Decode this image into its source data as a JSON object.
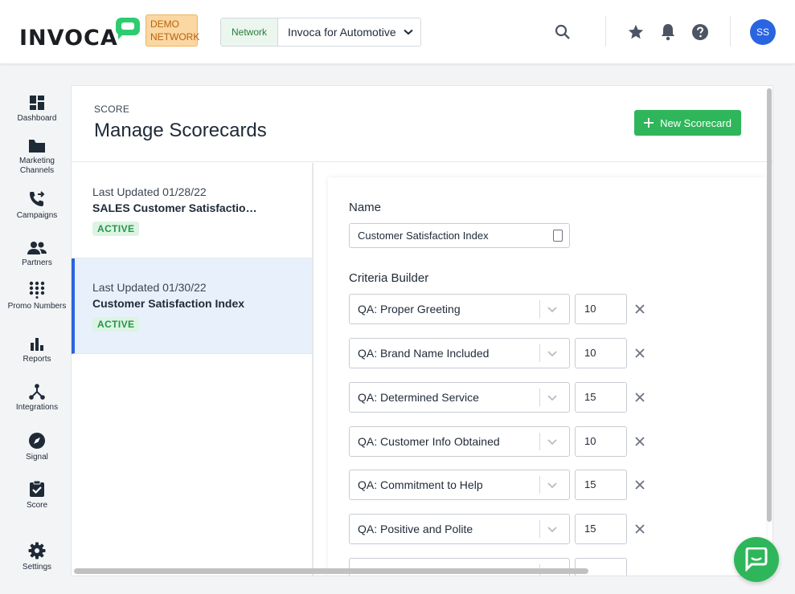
{
  "header": {
    "logo_text": "INVOCA",
    "demo_badge": "DEMO NETWORK",
    "network_tag": "Network",
    "network_value": "Invoca for Automotive",
    "avatar_initials": "SS",
    "icons": [
      "search-icon",
      "star-icon",
      "bell-icon",
      "help-icon"
    ]
  },
  "sidebar": {
    "items": [
      {
        "label": "Dashboard",
        "icon": "dashboard-icon"
      },
      {
        "label": "Marketing Channels",
        "icon": "folder-icon"
      },
      {
        "label": "Campaigns",
        "icon": "phone-forward-icon"
      },
      {
        "label": "Partners",
        "icon": "people-icon"
      },
      {
        "label": "Promo Numbers",
        "icon": "dialpad-icon"
      },
      {
        "label": "Reports",
        "icon": "bar-chart-icon"
      },
      {
        "label": "Integrations",
        "icon": "integrations-icon"
      },
      {
        "label": "Signal",
        "icon": "compass-icon"
      },
      {
        "label": "Score",
        "icon": "clipboard-check-icon"
      },
      {
        "label": "Settings",
        "icon": "gear-icon"
      }
    ]
  },
  "page": {
    "eyebrow": "SCORE",
    "title": "Manage Scorecards",
    "new_button": "New Scorecard"
  },
  "scorecards": [
    {
      "updated": "Last Updated 01/28/22",
      "name": "SALES Customer Satisfaction I...",
      "status": "ACTIVE",
      "selected": false
    },
    {
      "updated": "Last Updated 01/30/22",
      "name": "Customer Satisfaction Index",
      "status": "ACTIVE",
      "selected": true
    }
  ],
  "detail": {
    "name_label": "Name",
    "name_value": "Customer Satisfaction Index",
    "criteria_label": "Criteria Builder",
    "criteria": [
      {
        "criterion": "QA: Proper Greeting",
        "weight": "10"
      },
      {
        "criterion": "QA: Brand Name Included",
        "weight": "10"
      },
      {
        "criterion": "QA: Determined Service",
        "weight": "15"
      },
      {
        "criterion": "QA: Customer Info Obtained",
        "weight": "10"
      },
      {
        "criterion": "QA: Commitment to Help",
        "weight": "15"
      },
      {
        "criterion": "QA: Positive and Polite",
        "weight": "15"
      }
    ]
  },
  "colors": {
    "brand_green": "#2fb65a",
    "accent_blue": "#2a64e0",
    "demo_badge_bg": "#fbd7a2",
    "active_badge_bg": "#dcf4e3"
  }
}
